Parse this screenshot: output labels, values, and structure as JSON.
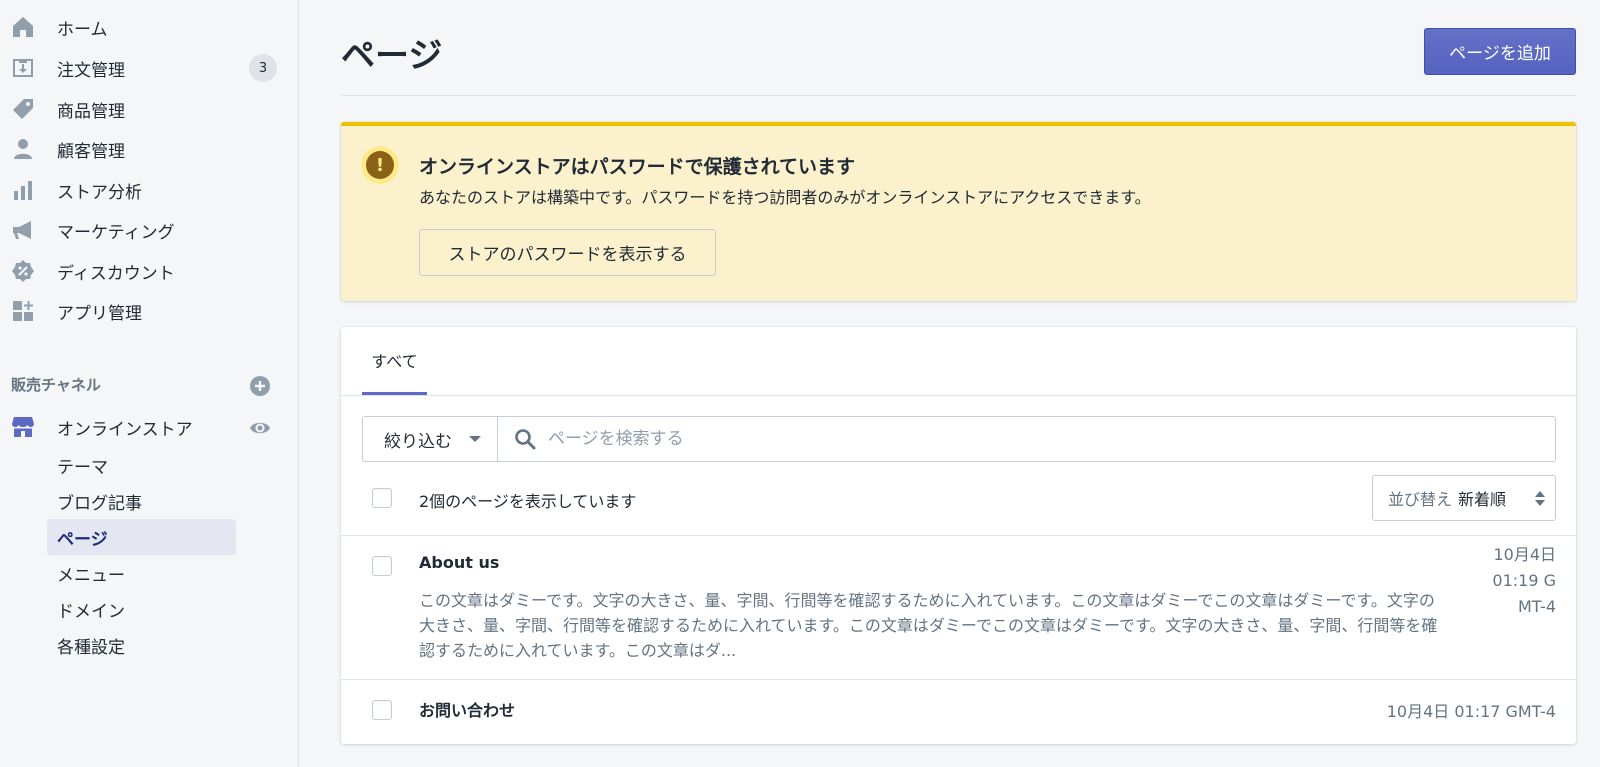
{
  "sidebar": {
    "items": [
      {
        "label": "ホーム",
        "icon": "home-icon"
      },
      {
        "label": "注文管理",
        "icon": "orders-icon",
        "badge": "3"
      },
      {
        "label": "商品管理",
        "icon": "tag-icon"
      },
      {
        "label": "顧客管理",
        "icon": "customer-icon"
      },
      {
        "label": "ストア分析",
        "icon": "analytics-icon"
      },
      {
        "label": "マーケティング",
        "icon": "megaphone-icon"
      },
      {
        "label": "ディスカウント",
        "icon": "discount-icon"
      },
      {
        "label": "アプリ管理",
        "icon": "apps-icon"
      }
    ],
    "sales_channels_title": "販売チャネル",
    "online_store": {
      "label": "オンラインストア",
      "sub_items": [
        "テーマ",
        "ブログ記事",
        "ページ",
        "メニュー",
        "ドメイン",
        "各種設定"
      ],
      "active_sub_item": "ページ"
    }
  },
  "header": {
    "title": "ページ",
    "add_button": "ページを追加"
  },
  "banner": {
    "title": "オンラインストアはパスワードで保護されています",
    "body": "あなたのストアは構築中です。パスワードを持つ訪問者のみがオンラインストアにアクセスできます。",
    "button": "ストアのパスワードを表示する"
  },
  "list": {
    "tab": "すべて",
    "filter_label": "絞り込む",
    "search_placeholder": "ページを検索する",
    "count_text": "2個のページを表示しています",
    "sort_label": "並び替え",
    "sort_value": "新着順",
    "rows": [
      {
        "title": "About us",
        "excerpt": "この文章はダミーです。文字の大きさ、量、字間、行間等を確認するために入れています。この文章はダミーでこの文章はダミーです。文字の大きさ、量、字間、行間等を確認するために入れています。この文章はダミーでこの文章はダミーです。文字の大きさ、量、字間、行間等を確認するために入れています。この文章はダ...",
        "date_lines": [
          "10月4日",
          "01:19 G",
          "MT-4"
        ]
      },
      {
        "title": "お問い合わせ",
        "date": "10月4日 01:17 GMT-4"
      }
    ]
  },
  "colors": {
    "accent": "#5c6ac4",
    "banner_bg": "#fcf1cd",
    "banner_border": "#eec200",
    "sidebar_bg": "#f4f6f8"
  }
}
